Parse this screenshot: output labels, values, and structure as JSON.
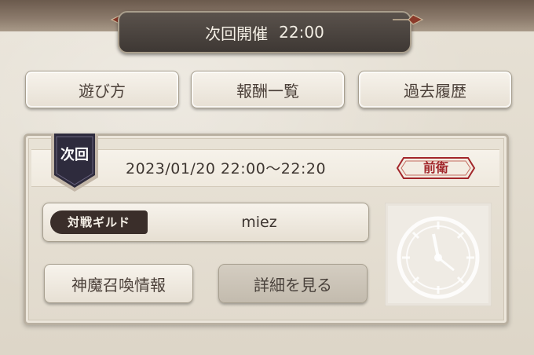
{
  "header": {
    "title": "次回開催",
    "time": "22:00"
  },
  "top_buttons": [
    {
      "label": "遊び方"
    },
    {
      "label": "報酬一覧"
    },
    {
      "label": "過去履歴"
    }
  ],
  "match": {
    "badge": "次回",
    "datetime": "2023/01/20  22:00〜22:20",
    "position": "前衛",
    "opponent_label": "対戦ギルド",
    "opponent_name": "miez"
  },
  "actions": {
    "summon_info": "神魔召喚情報",
    "details": "詳細を見る"
  },
  "colors": {
    "banner_bg": "#3e3834",
    "badge_bg": "#2e2b3d",
    "position_red": "#a2262a",
    "guild_tag_bg": "#3a2e2a"
  }
}
